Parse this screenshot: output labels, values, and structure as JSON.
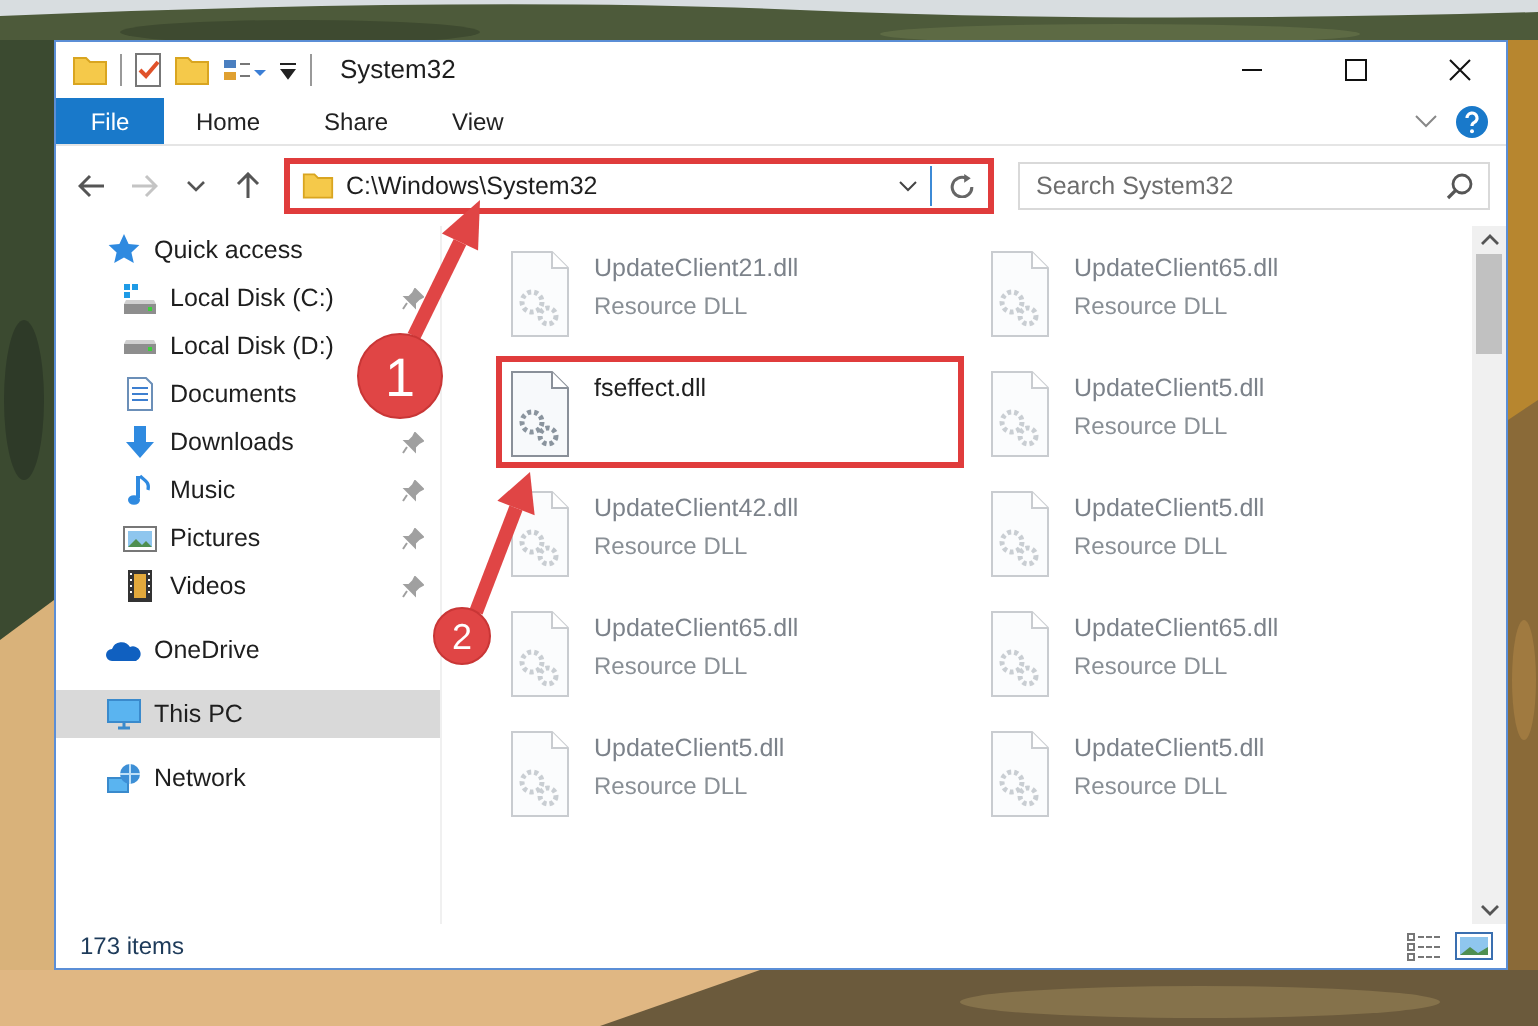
{
  "window": {
    "title": "System32"
  },
  "ribbon_tabs": [
    {
      "label": "File",
      "kind": "file"
    },
    {
      "label": "Home",
      "kind": "tab"
    },
    {
      "label": "Share",
      "kind": "tab"
    },
    {
      "label": "View",
      "kind": "tab"
    }
  ],
  "nav_buttons": [
    {
      "kind": "back",
      "disabled": false
    },
    {
      "kind": "forward",
      "disabled": true
    },
    {
      "kind": "recent",
      "disabled": false
    },
    {
      "kind": "up",
      "disabled": false
    }
  ],
  "address": {
    "path": "C:\\Windows\\System32",
    "highlighted": true
  },
  "search": {
    "placeholder": "Search System32"
  },
  "sidebar": {
    "items": [
      {
        "label": "Quick access",
        "kind": "star",
        "selected": false,
        "children": [
          {
            "label": "Local Disk (C:)",
            "kind": "drive-windows",
            "selected": false,
            "pinned": true
          },
          {
            "label": "Local Disk (D:)",
            "kind": "drive",
            "selected": false
          },
          {
            "label": "Documents",
            "kind": "documents",
            "selected": false
          },
          {
            "label": "Downloads",
            "kind": "downloads",
            "selected": false,
            "pinned": true
          },
          {
            "label": "Music",
            "kind": "music",
            "selected": false,
            "pinned": true
          },
          {
            "label": "Pictures",
            "kind": "pictures",
            "selected": false,
            "pinned": true
          },
          {
            "label": "Videos",
            "kind": "videos",
            "selected": false,
            "pinned": true
          }
        ]
      },
      {
        "label": "OneDrive",
        "kind": "cloud",
        "selected": false
      },
      {
        "label": "This PC",
        "kind": "computer",
        "selected": true
      },
      {
        "label": "Network",
        "kind": "network",
        "selected": false
      }
    ]
  },
  "files": [
    {
      "name": "UpdateClient21.dll",
      "type": "Resource DLL",
      "blurred": true,
      "highlighted": false
    },
    {
      "name": "UpdateClient65.dll",
      "type": "Resource DLL",
      "blurred": true,
      "highlighted": false
    },
    {
      "name": "fseffect.dll",
      "blurred": false,
      "highlighted": true
    },
    {
      "name": "UpdateClient5.dll",
      "type": "Resource DLL",
      "blurred": true,
      "highlighted": false
    },
    {
      "name": "UpdateClient42.dll",
      "type": "Resource DLL",
      "blurred": true,
      "highlighted": false
    },
    {
      "name": "UpdateClient5.dll",
      "type": "Resource DLL",
      "blurred": true,
      "highlighted": false
    },
    {
      "name": "UpdateClient65.dll",
      "type": "Resource DLL",
      "blurred": true,
      "highlighted": false
    },
    {
      "name": "UpdateClient65.dll",
      "type": "Resource DLL",
      "blurred": true,
      "highlighted": false
    },
    {
      "name": "UpdateClient5.dll",
      "type": "Resource DLL",
      "blurred": true,
      "highlighted": false
    },
    {
      "name": "UpdateClient5.dll",
      "type": "Resource DLL",
      "blurred": true,
      "highlighted": false
    }
  ],
  "callouts": [
    {
      "number": "1"
    },
    {
      "number": "2"
    }
  ],
  "status_bar": {
    "item_count": "173 items"
  }
}
